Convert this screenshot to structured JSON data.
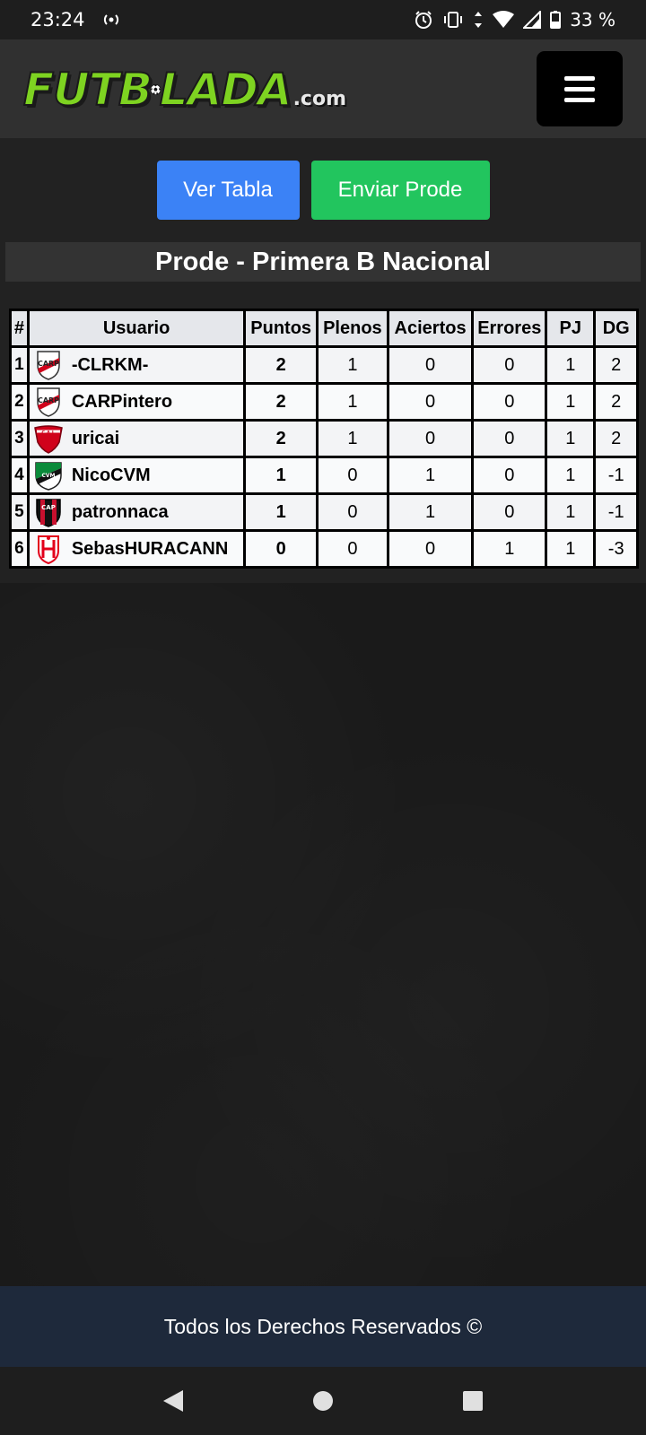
{
  "status_bar": {
    "time": "23:24",
    "battery": "33 %"
  },
  "header": {
    "logo_text_a": "FUTB",
    "logo_text_b": "LADA",
    "logo_suffix": ".com"
  },
  "buttons": {
    "ver_tabla": "Ver Tabla",
    "enviar_prode": "Enviar Prode"
  },
  "section_title": "Prode - Primera B Nacional",
  "table": {
    "headers": [
      "#",
      "Usuario",
      "Puntos",
      "Plenos",
      "Aciertos",
      "Errores",
      "PJ",
      "DG"
    ],
    "rows": [
      {
        "rank": "1",
        "user": "-CLRKM-",
        "crest": "river-plate-crest-icon",
        "puntos": "2",
        "plenos": "1",
        "aciertos": "0",
        "errores": "0",
        "pj": "1",
        "dg": "2"
      },
      {
        "rank": "2",
        "user": "CARPintero",
        "crest": "river-plate-crest-icon",
        "puntos": "2",
        "plenos": "1",
        "aciertos": "0",
        "errores": "0",
        "pj": "1",
        "dg": "2"
      },
      {
        "rank": "3",
        "user": "uricai",
        "crest": "independiente-crest-icon",
        "puntos": "2",
        "plenos": "1",
        "aciertos": "0",
        "errores": "0",
        "pj": "1",
        "dg": "2"
      },
      {
        "rank": "4",
        "user": "NicoCVM",
        "crest": "cvm-crest-icon",
        "puntos": "1",
        "plenos": "0",
        "aciertos": "1",
        "errores": "0",
        "pj": "1",
        "dg": "-1"
      },
      {
        "rank": "5",
        "user": "patronnaca",
        "crest": "patronato-crest-icon",
        "puntos": "1",
        "plenos": "0",
        "aciertos": "1",
        "errores": "0",
        "pj": "1",
        "dg": "-1"
      },
      {
        "rank": "6",
        "user": "SebasHURACANN",
        "crest": "huracan-crest-icon",
        "puntos": "0",
        "plenos": "0",
        "aciertos": "0",
        "errores": "1",
        "pj": "1",
        "dg": "-3"
      }
    ]
  },
  "footer": {
    "text": "Todos los Derechos Reservados ©"
  },
  "colors": {
    "blue_button": "#3b82f6",
    "green_button": "#22c55e",
    "logo_green": "#7ed321",
    "footer_bg": "#1e293b"
  }
}
